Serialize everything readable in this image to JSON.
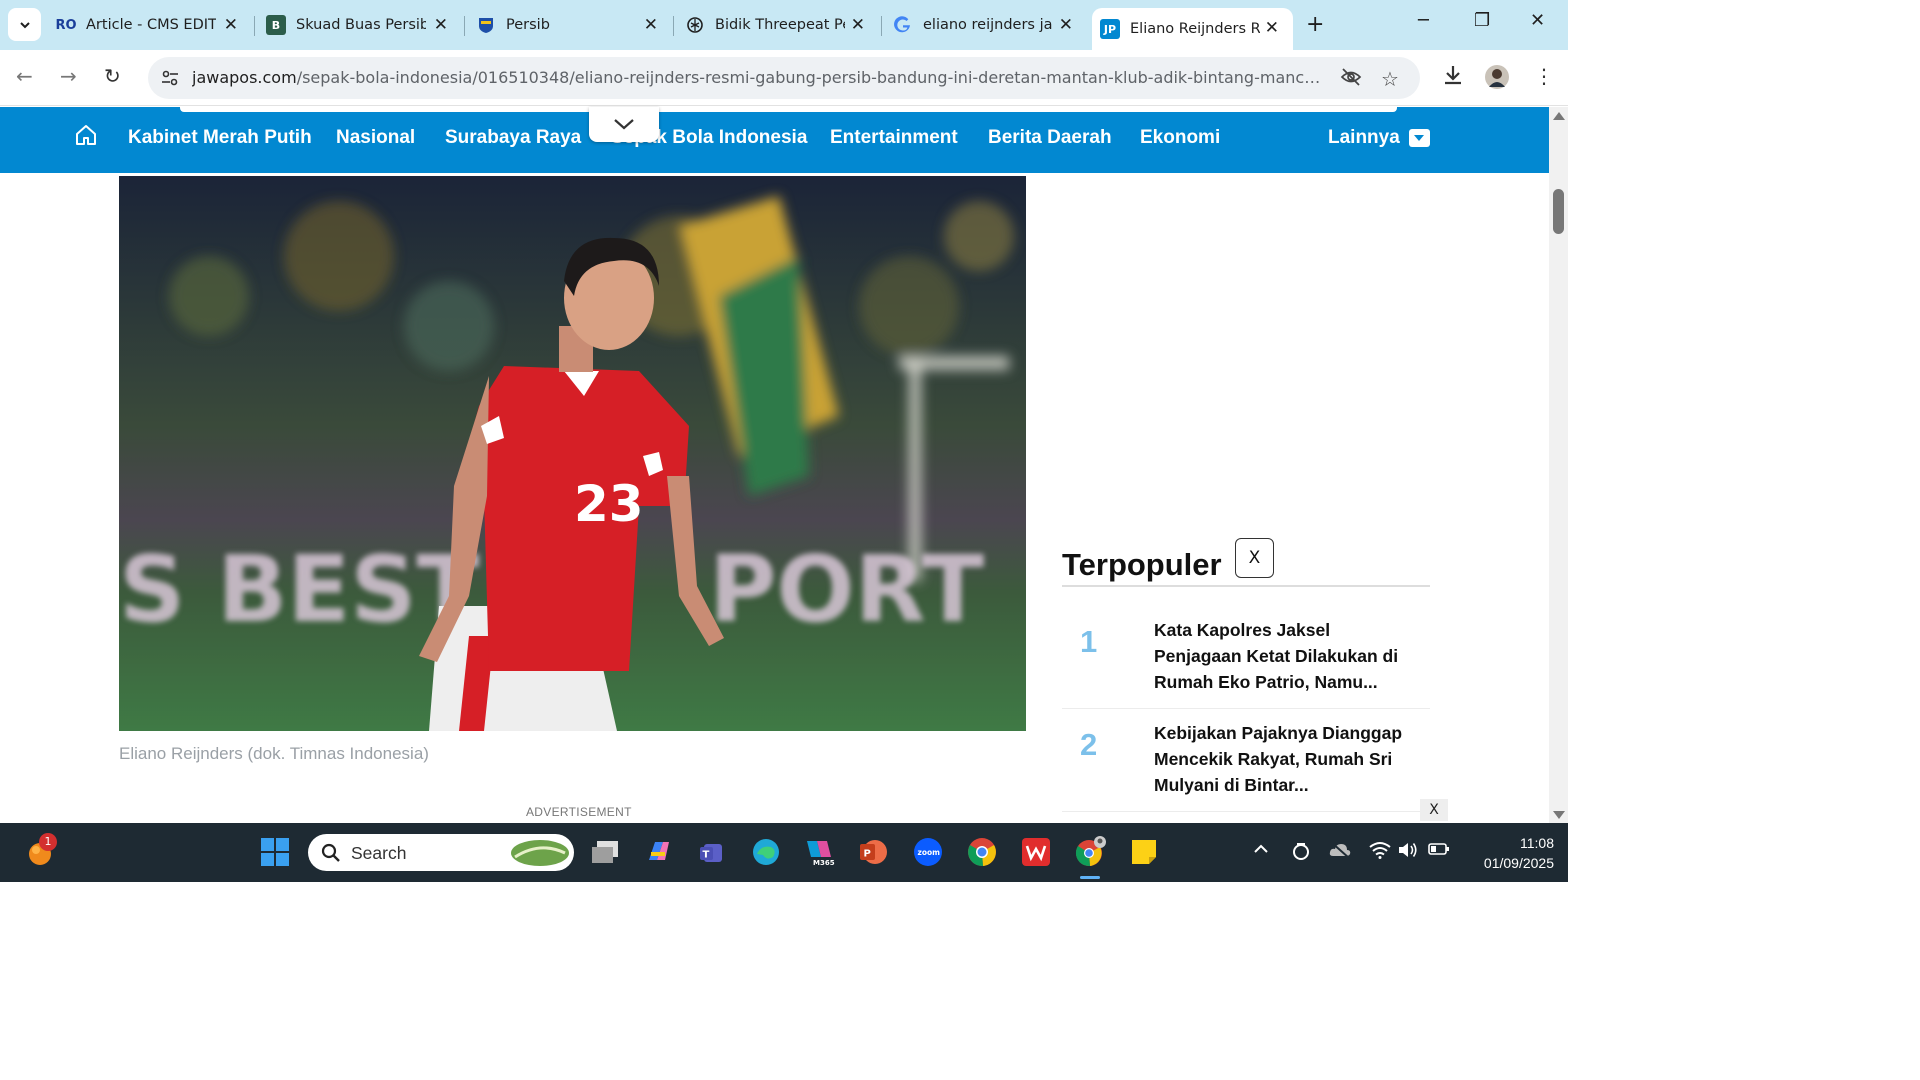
{
  "browser": {
    "tabs": [
      {
        "title": "Article - CMS EDITOR",
        "favicon": "ro-icon",
        "active": false
      },
      {
        "title": "Skuad Buas Persib",
        "favicon": "b-icon",
        "active": false
      },
      {
        "title": "Persib",
        "favicon": "persib-icon",
        "active": false
      },
      {
        "title": "Bidik Threepeat Persib",
        "favicon": "openai-icon",
        "active": false
      },
      {
        "title": "eliano reijnders jawapos",
        "favicon": "google-icon",
        "active": false
      },
      {
        "title": "Eliano Reijnders Resmi",
        "favicon": "jp-icon",
        "active": true
      }
    ],
    "url_host": "jawapos.com",
    "url_path": "/sepak-bola-indonesia/016510348/eliano-reijnders-resmi-gabung-persib-bandung-ini-deretan-mantan-klub-adik-bintang-manchester..."
  },
  "site_nav": {
    "items": [
      "Kabinet Merah Putih",
      "Nasional",
      "Surabaya Raya",
      "Sepak Bola Indonesia",
      "Entertainment",
      "Berita Daerah",
      "Ekonomi"
    ],
    "more": "Lainnya"
  },
  "article": {
    "caption": "Eliano Reijnders (dok. Timnas Indonesia)",
    "jersey_number": "23",
    "ad_label": "ADVERTISEMENT"
  },
  "sidebar": {
    "popular_title": "Terpopuler",
    "close_label": "X",
    "items": [
      {
        "rank": "1",
        "text": "Kata Kapolres Jaksel Penjagaan Ketat Dilakukan di Rumah Eko Patrio, Namu..."
      },
      {
        "rank": "2",
        "text": "Kebijakan Pajaknya Dianggap Mencekik Rakyat, Rumah Sri Mulyani di Bintar..."
      }
    ],
    "ad_close": "X"
  },
  "taskbar": {
    "search_label": "Search",
    "notification_count": "1",
    "time": "11:08",
    "date": "01/09/2025"
  },
  "colors": {
    "nav_bg": "#0288d1",
    "tabstrip_bg": "#c8e8f4",
    "taskbar_bg": "#1e2a33",
    "rank_color": "#7cc0ea"
  }
}
